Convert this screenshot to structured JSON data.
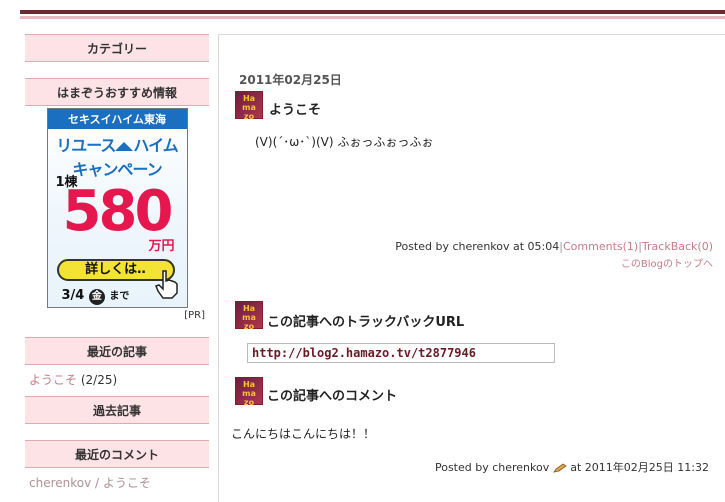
{
  "sidebar": {
    "categories_heading": "カテゴリー",
    "recommend_heading": "はまぞうおすすめ情報",
    "banner": {
      "line1": "セキスイハイム東海",
      "line2a": "リユース",
      "line2b": "ハイム",
      "line3": "キャンペーン",
      "line4": "1棟",
      "price": "580",
      "unit": "万円",
      "button": "詳しくは‥",
      "until_date": "3/4",
      "until_day": "金",
      "until_suffix": "まで"
    },
    "pr_label": "[PR]",
    "recent_posts_heading": "最近の記事",
    "recent_post_link": "ようこそ",
    "recent_post_date": "(2/25)",
    "past_posts_heading": "過去記事",
    "recent_comments_heading": "最近のコメント",
    "recent_comment": "cherenkov / ようこそ"
  },
  "post": {
    "date": "2011年02月25日",
    "title": "ようこそ",
    "body": "(V)(´･ω･`)(V) ふぉっふぉっふぉ",
    "posted_by": "Posted by cherenkov at 05:04",
    "comments_link": "Comments(1)",
    "trackback_link": "TrackBack(0)",
    "top_link": "このBlogのトップへ"
  },
  "trackback": {
    "heading": "この記事へのトラックバックURL",
    "url": "http://blog2.hamazo.tv/t2877946"
  },
  "comments": {
    "heading": "この記事へのコメント",
    "text": "こんにちはこんにちは！！",
    "posted_by": "Posted by cherenkov",
    "posted_at": "at 2011年02月25日 11:32"
  },
  "icon_label": "Ha ma zo",
  "colors": {
    "accent": "#6b2b33",
    "sidebar_head_bg": "#fde3e6",
    "link_pink": "#c87c88",
    "banner_red": "#e6174f",
    "banner_blue": "#1b6fc0"
  }
}
